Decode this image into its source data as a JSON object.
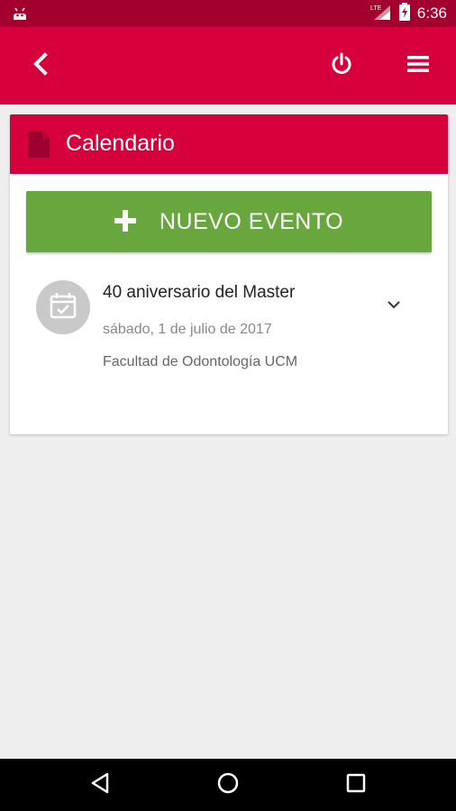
{
  "status_bar": {
    "time": "6:36",
    "network_label": "LTE",
    "icons": [
      "android-icon",
      "lte-signal-icon",
      "battery-charging-icon"
    ]
  },
  "app_bar": {
    "icons": [
      "back-arrow-icon",
      "power-icon",
      "hamburger-menu-icon"
    ]
  },
  "card": {
    "title": "Calendario",
    "header_icon": "document-icon",
    "new_event_label": "NUEVO EVENTO",
    "new_event_icon": "plus-icon"
  },
  "events": [
    {
      "title": "40 aniversario del Master",
      "date": "sábado, 1 de julio de 2017",
      "place": "Facultad de Odontología UCM",
      "icon": "calendar-check-icon"
    }
  ],
  "nav_bar": {
    "icons": [
      "back-triangle-icon",
      "home-circle-icon",
      "recents-square-icon"
    ]
  },
  "colors": {
    "status_bar": "#a3002f",
    "primary": "#d5003c",
    "accent_green": "#67a73d",
    "background": "#eeeeee"
  }
}
